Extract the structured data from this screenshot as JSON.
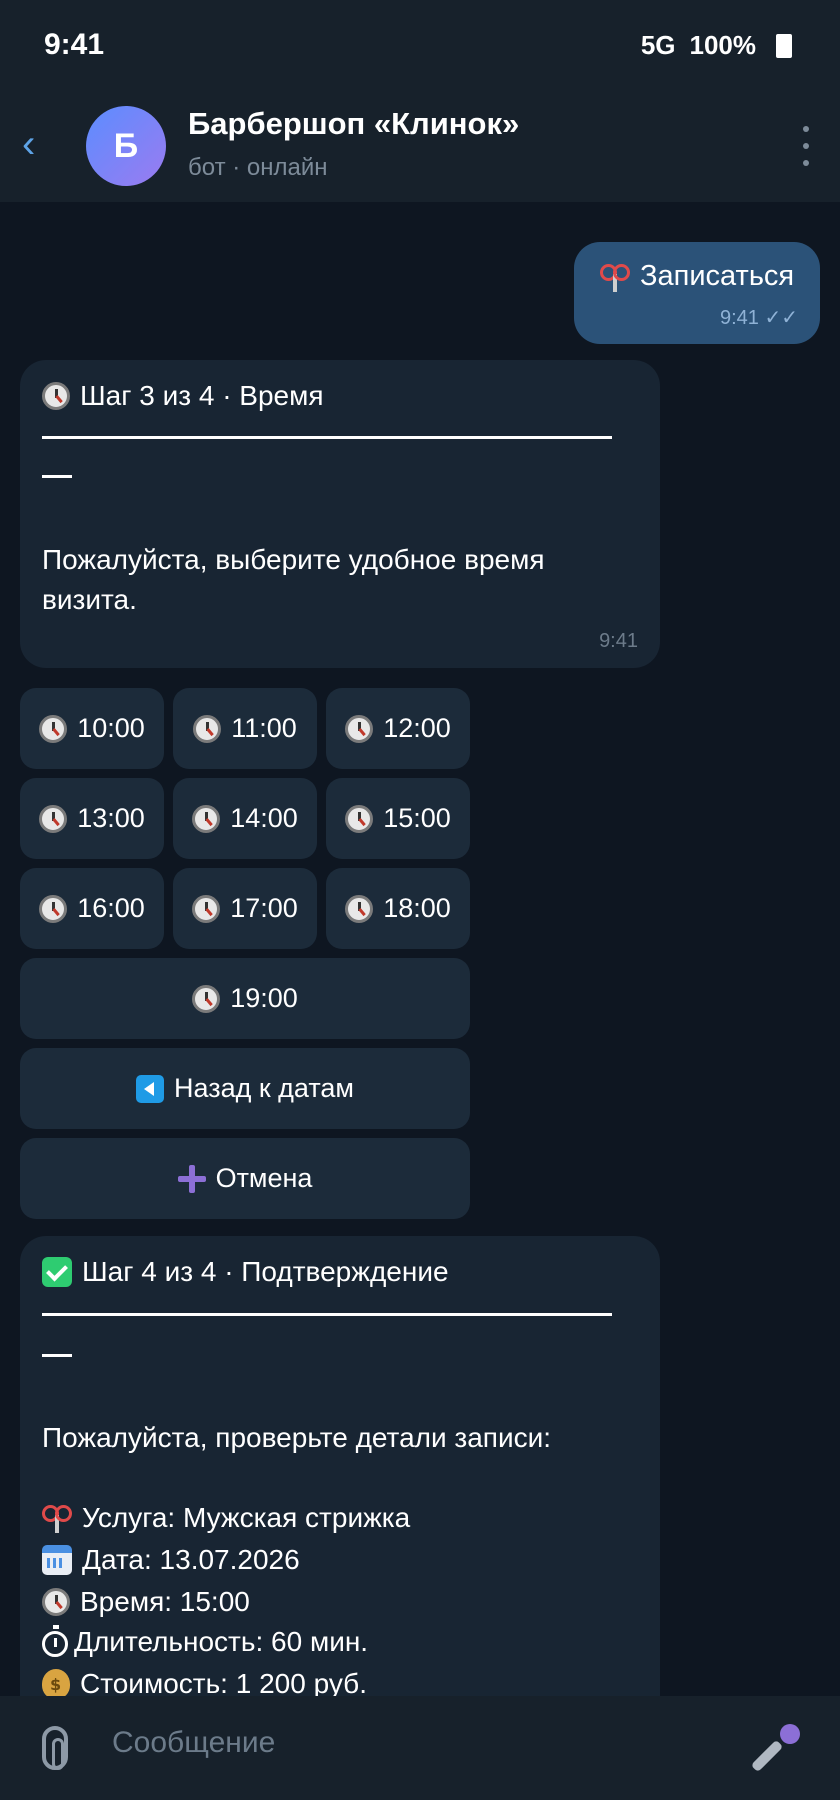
{
  "status": {
    "time": "9:41",
    "network": "5G",
    "battery": "100%"
  },
  "header": {
    "avatar_letter": "Б",
    "title": "Барбершоп «Клинок»",
    "subtitle": "бот · онлайн"
  },
  "outgoing": {
    "text": "Записаться",
    "time": "9:41 ✓✓"
  },
  "step3": {
    "title": "Шаг 3 из 4 · Время",
    "dash": "—",
    "body_line1": "Пожалуйста, выберите удобное время",
    "body_line2": "визита.",
    "time": "9:41"
  },
  "keyboard": {
    "slots": [
      "10:00",
      "11:00",
      "12:00",
      "13:00",
      "14:00",
      "15:00",
      "16:00",
      "17:00",
      "18:00",
      "19:00"
    ],
    "back_label": "Назад к датам",
    "cancel_label": "Отмена"
  },
  "step4": {
    "title": "Шаг 4 из 4 · Подтверждение",
    "dash": "—",
    "intro": "Пожалуйста, проверьте детали записи:",
    "service": "Услуга: Мужская стрижка",
    "date": "Дата: 13.07.2026",
    "time_line": "Время: 15:00",
    "duration": "Длительность: 60 мин.",
    "price": "Стоимость: 1 200 руб."
  },
  "composer": {
    "placeholder": "Сообщение"
  },
  "icons": {
    "time_slot": "clock-icon",
    "back": "back-triangle-icon",
    "cancel": "plus-icon",
    "service": "scissors-icon",
    "date": "calendar-icon",
    "duration": "stopwatch-icon",
    "price": "moneybag-icon"
  }
}
